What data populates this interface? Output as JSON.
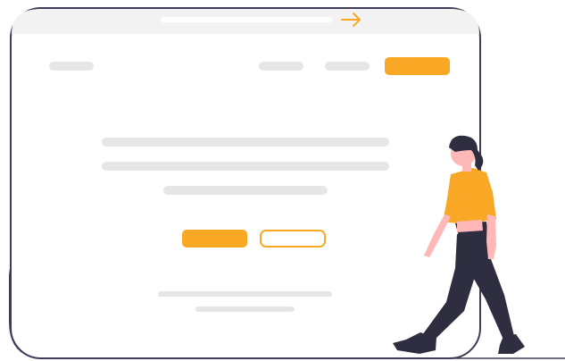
{
  "colors": {
    "accent": "#f9a826",
    "outline": "#3f3d56",
    "placeholder": "#e6e6e6",
    "browser_bar": "#f2f2f2",
    "skin": "#ffb8b8",
    "hair": "#2f2e41",
    "pants": "#2f2e41",
    "shirt": "#f9a826"
  },
  "icons": {
    "address_arrow": "arrow-right-icon"
  },
  "illustration": {
    "subject": "person-walking",
    "elements": [
      "browser-window",
      "address-bar",
      "nav-placeholders",
      "primary-cta",
      "secondary-cta",
      "text-lines"
    ]
  }
}
